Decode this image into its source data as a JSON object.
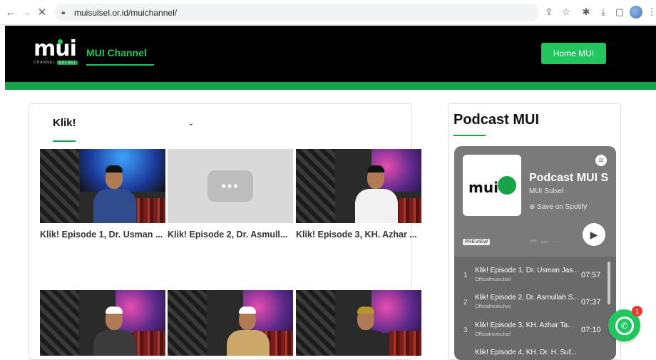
{
  "browser": {
    "url": "muisulsel.or.id/muichannel/",
    "back_icon": "back-arrow-icon",
    "forward_icon": "forward-arrow-icon",
    "close_icon": "close-icon"
  },
  "header": {
    "logo_text": "mui",
    "logo_sub": "CHANNEL",
    "logo_sub_badge": "SULSEL",
    "channel_title": "MUI Channel",
    "home_button": "Home MUI"
  },
  "colors": {
    "brand_green": "#22c55e",
    "header_bg": "#000000",
    "spotify_card": "#7a7a7a"
  },
  "main": {
    "select_value": "Klik!",
    "videos": [
      {
        "title": "Klik! Episode 1, Dr. Usman ..."
      },
      {
        "title": "Klik! Episode 2, Dr. Asmull..."
      },
      {
        "title": "Klik! Episode 3, KH. Azhar ..."
      }
    ]
  },
  "podcast": {
    "section_title": "Podcast MUI",
    "cover_text": "mui",
    "show_name": "Podcast MUI S",
    "author": "MUI Sulsel",
    "save_label": "Save on Spotify",
    "preview_label": "PREVIEW",
    "tracks": [
      {
        "num": "1",
        "title": "Klik! Episode 1, Dr. Usman Jas...",
        "artist": "Officialmuisulsel",
        "duration": "07:57"
      },
      {
        "num": "2",
        "title": "Klik! Episode 2, Dr. Asmullah S...",
        "artist": "Officialmuisulsel",
        "duration": "07:37"
      },
      {
        "num": "3",
        "title": "Klik! Episode 3, KH. Azhar Ta...",
        "artist": "Officialmuisulsel",
        "duration": "07:10"
      },
      {
        "num": "",
        "title": "Klik! Episode 4, KH. Dr. H. Suf...",
        "artist": "",
        "duration": ""
      }
    ]
  },
  "whatsapp": {
    "badge": "1"
  }
}
